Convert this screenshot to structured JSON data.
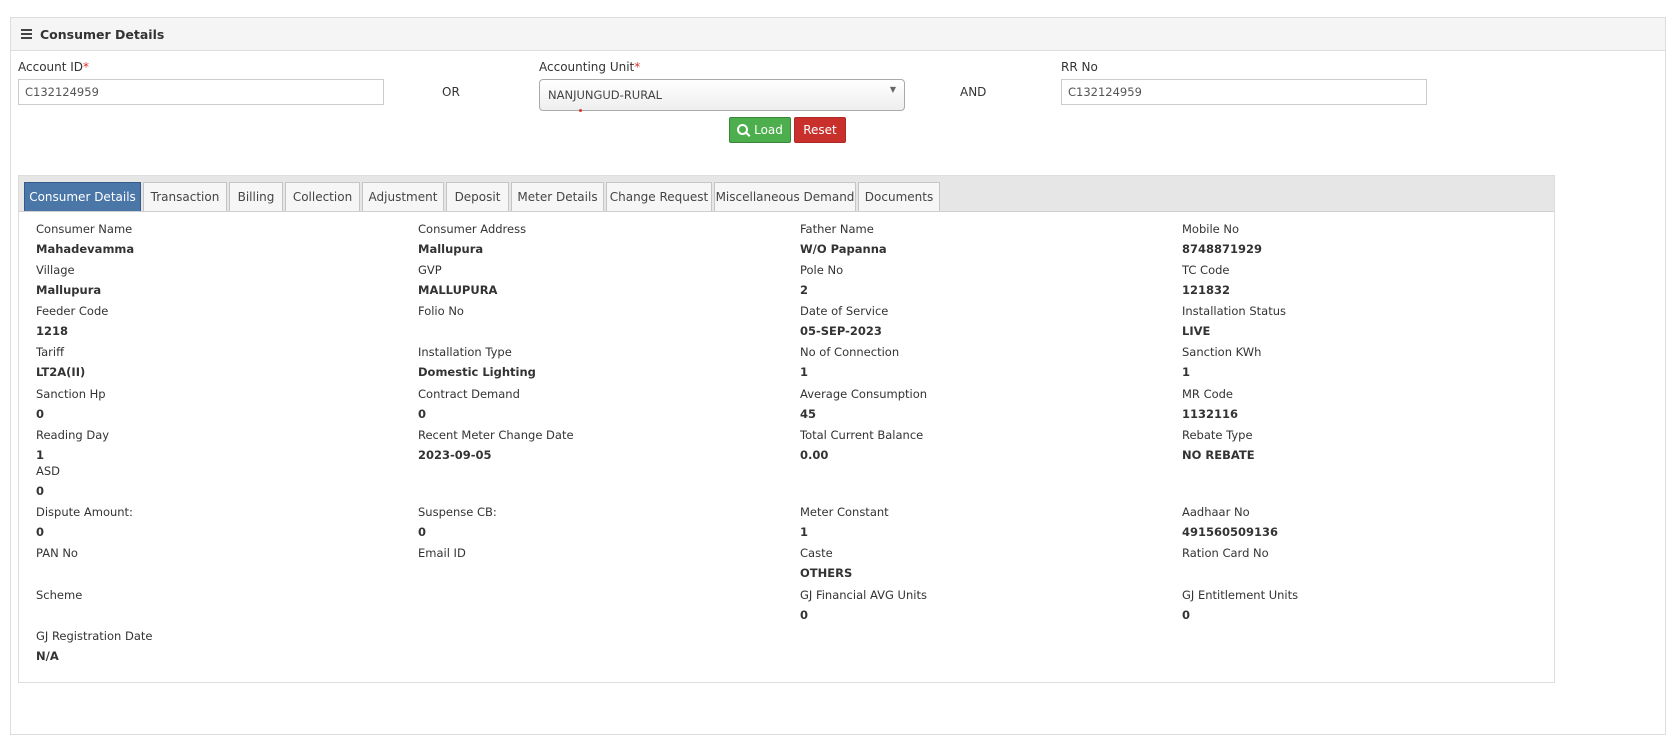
{
  "panel": {
    "title": "Consumer Details"
  },
  "search": {
    "account_id_label": "Account ID",
    "required_mark": "*",
    "account_id_value": "C132124959",
    "or_label": "OR",
    "accounting_unit_label": "Accounting Unit",
    "accounting_unit_value": "NANJUNGUD-RURAL",
    "and_label": "AND",
    "rr_no_label": "RR No",
    "rr_no_value": "C132124959",
    "load_label": "Load",
    "reset_label": "Reset"
  },
  "tabs": [
    {
      "label": "Consumer Details"
    },
    {
      "label": "Transaction"
    },
    {
      "label": "Billing"
    },
    {
      "label": "Collection"
    },
    {
      "label": "Adjustment"
    },
    {
      "label": "Deposit"
    },
    {
      "label": "Meter Details"
    },
    {
      "label": "Change Request"
    },
    {
      "label": "Miscellaneous Demand"
    },
    {
      "label": "Documents"
    }
  ],
  "details": {
    "consumer_name": {
      "label": "Consumer Name",
      "value": "Mahadevamma"
    },
    "consumer_address": {
      "label": "Consumer Address",
      "value": "Mallupura"
    },
    "father_name": {
      "label": "Father Name",
      "value": "W/O Papanna"
    },
    "mobile_no": {
      "label": "Mobile No",
      "value": "8748871929"
    },
    "village": {
      "label": "Village",
      "value": "Mallupura"
    },
    "gvp": {
      "label": "GVP",
      "value": "MALLUPURA"
    },
    "pole_no": {
      "label": "Pole No",
      "value": "2"
    },
    "tc_code": {
      "label": "TC Code",
      "value": "121832"
    },
    "feeder_code": {
      "label": "Feeder Code",
      "value": "1218"
    },
    "folio_no": {
      "label": "Folio No",
      "value": ""
    },
    "date_of_service": {
      "label": "Date of Service",
      "value": "05-SEP-2023"
    },
    "installation_status": {
      "label": "Installation Status",
      "value": "LIVE"
    },
    "tariff": {
      "label": "Tariff",
      "value": "LT2A(II)"
    },
    "installation_type": {
      "label": "Installation Type",
      "value": "Domestic Lighting"
    },
    "no_of_connection": {
      "label": "No of Connection",
      "value": "1"
    },
    "sanction_kwh": {
      "label": "Sanction KWh",
      "value": "1"
    },
    "sanction_hp": {
      "label": "Sanction Hp",
      "value": "0"
    },
    "contract_demand": {
      "label": "Contract Demand",
      "value": "0"
    },
    "average_consumption": {
      "label": "Average Consumption",
      "value": "45"
    },
    "mr_code": {
      "label": "MR Code",
      "value": "1132116"
    },
    "reading_day": {
      "label": "Reading Day",
      "value": "1"
    },
    "recent_meter_change_date": {
      "label": "Recent Meter Change Date",
      "value": "2023-09-05"
    },
    "total_current_balance": {
      "label": "Total Current Balance",
      "value": "0.00"
    },
    "rebate_type": {
      "label": "Rebate Type",
      "value": "NO REBATE"
    },
    "asd": {
      "label": "ASD",
      "value": "0"
    },
    "dispute_amount": {
      "label": "Dispute Amount:",
      "value": "0"
    },
    "suspense_cb": {
      "label": "Suspense CB:",
      "value": "0"
    },
    "meter_constant": {
      "label": "Meter Constant",
      "value": "1"
    },
    "aadhaar_no": {
      "label": "Aadhaar No",
      "value": "491560509136"
    },
    "pan_no": {
      "label": "PAN No",
      "value": ""
    },
    "email_id": {
      "label": "Email ID",
      "value": ""
    },
    "caste": {
      "label": "Caste",
      "value": "OTHERS"
    },
    "ration_card_no": {
      "label": "Ration Card No",
      "value": ""
    },
    "scheme": {
      "label": "Scheme",
      "value": ""
    },
    "gj_financial_avg_units": {
      "label": "GJ Financial AVG Units",
      "value": "0"
    },
    "gj_entitlement_units": {
      "label": "GJ Entitlement Units",
      "value": "0"
    },
    "gj_registration_date": {
      "label": "GJ Registration Date",
      "value": "N/A"
    }
  },
  "colors": {
    "tab_active": "#4a77a8",
    "load_button": "#4cae4c",
    "reset_button": "#c9302c",
    "required": "#d9342b"
  }
}
